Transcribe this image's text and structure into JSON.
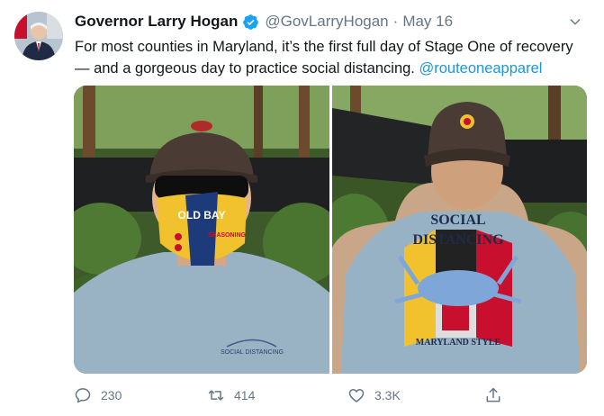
{
  "tweet": {
    "author_name": "Governor Larry Hogan",
    "handle": "@GovLarryHogan",
    "separator": "·",
    "date": "May 16",
    "text": "For most counties in Maryland, it’s the first full day of Stage One of recovery — and a gorgeous day to practice social distancing. ",
    "mention": "@routeoneapparel"
  },
  "photos": {
    "left": {
      "mask_text_top": "OLD BAY",
      "mask_text_side": "SEASONING",
      "shirt_text": "SOCIAL DISTANCING"
    },
    "right": {
      "shirt_title_1": "SOCIAL",
      "shirt_title_2": "DISTANCING",
      "shirt_bottom": "MARYLAND STYLE"
    }
  },
  "actions": {
    "reply_count": "230",
    "retweet_count": "414",
    "like_count": "3.3K"
  },
  "icons": {
    "verified": "verified-badge-icon",
    "caret": "chevron-down-icon",
    "reply": "reply-icon",
    "retweet": "retweet-icon",
    "like": "heart-icon",
    "share": "share-icon"
  },
  "colors": {
    "link": "#1b95e0",
    "verified": "#1da1f2",
    "muted": "#657786"
  }
}
